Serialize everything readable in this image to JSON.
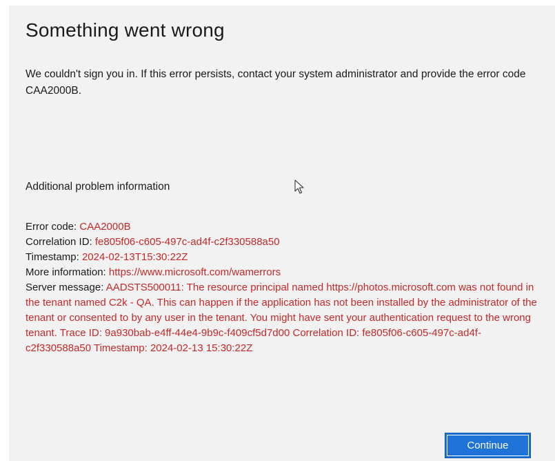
{
  "dialog": {
    "title": "Something went wrong",
    "message": "We couldn't sign you in. If this error persists, contact your system administrator and provide the error code CAA2000B.",
    "additional_heading": "Additional problem information",
    "details": {
      "error_code_label": "Error code: ",
      "error_code_value": "CAA2000B",
      "correlation_label": "Correlation ID: ",
      "correlation_value": "fe805f06-c605-497c-ad4f-c2f330588a50",
      "timestamp_label": "Timestamp: ",
      "timestamp_value": "2024-02-13T15:30:22Z",
      "more_info_label": "More information: ",
      "more_info_value": "https://www.microsoft.com/wamerrors",
      "server_message_label": "Server message: ",
      "server_message_value": "AADSTS500011: The resource principal named https://photos.microsoft.com was not found in the tenant named C2k - QA. This can happen if the application has not been installed by the administrator of the tenant or consented to by any user in the tenant. You might have sent your authentication request to the wrong tenant. Trace ID: 9a930bab-e4ff-44e4-9b9c-f409cf5d7d00 Correlation ID: fe805f06-c605-497c-ad4f-c2f330588a50 Timestamp: 2024-02-13 15:30:22Z"
    },
    "continue_label": "Continue"
  },
  "colors": {
    "background": "#f2f2f2",
    "error_value": "#c62828",
    "accent_button": "#1f73d6"
  },
  "icons": {
    "cursor": "mouse-pointer-icon"
  }
}
